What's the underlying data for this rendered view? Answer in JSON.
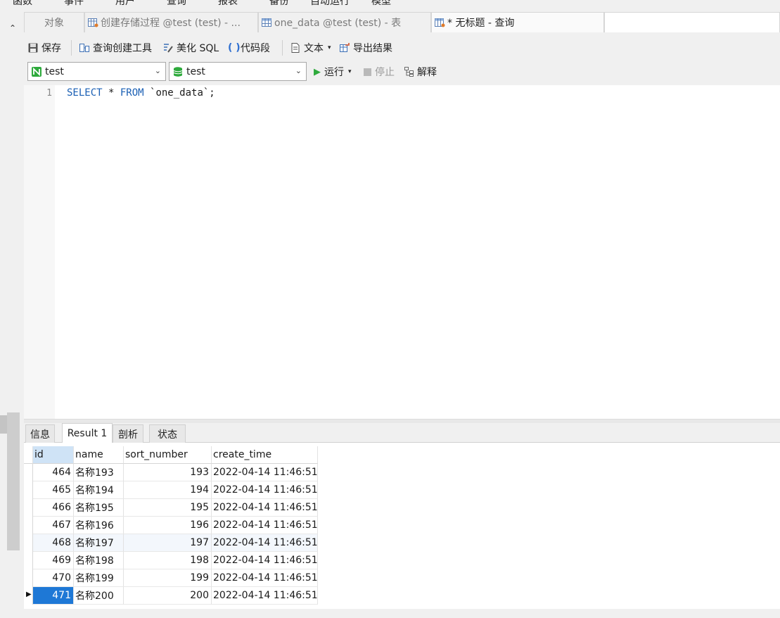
{
  "menu": [
    "函数",
    "事件",
    "用户",
    "查询",
    "报表",
    "备份",
    "自动运行",
    "模型"
  ],
  "tabs": [
    {
      "label": "对象",
      "icon": "",
      "active": false
    },
    {
      "label": "创建存储过程 @test (test) - ...",
      "icon": "procedure-table-icon",
      "active": false
    },
    {
      "label": "one_data @test (test) - 表",
      "icon": "table-icon",
      "active": false
    },
    {
      "label": "* 无标题 - 查询",
      "icon": "query-icon",
      "active": true
    }
  ],
  "toolbar": {
    "save": "保存",
    "query_builder": "查询创建工具",
    "beautify_sql": "美化 SQL",
    "code_snippet": "代码段",
    "text": "文本",
    "export_results": "导出结果"
  },
  "selectors": {
    "connection": "test",
    "database": "test",
    "run": "运行",
    "stop": "停止",
    "explain": "解释"
  },
  "editor": {
    "line_number": "1",
    "sql_keyword_select": "SELECT",
    "sql_star": " * ",
    "sql_keyword_from": "FROM",
    "sql_rest": " `one_data`;"
  },
  "result_tabs": [
    "信息",
    "Result 1",
    "剖析",
    "状态"
  ],
  "columns": [
    "id",
    "name",
    "sort_number",
    "create_time"
  ],
  "rows": [
    [
      "464",
      "名称193",
      "193",
      "2022-04-14 11:46:51"
    ],
    [
      "465",
      "名称194",
      "194",
      "2022-04-14 11:46:51"
    ],
    [
      "466",
      "名称195",
      "195",
      "2022-04-14 11:46:51"
    ],
    [
      "467",
      "名称196",
      "196",
      "2022-04-14 11:46:51"
    ],
    [
      "468",
      "名称197",
      "197",
      "2022-04-14 11:46:51"
    ],
    [
      "469",
      "名称198",
      "198",
      "2022-04-14 11:46:51"
    ],
    [
      "470",
      "名称199",
      "199",
      "2022-04-14 11:46:51"
    ],
    [
      "471",
      "名称200",
      "200",
      "2022-04-14 11:46:51"
    ]
  ],
  "colors": {
    "keyword": "#1a5fb4",
    "selected_cell": "#1e78d6",
    "run_green": "#2eaa3c",
    "header_selected": "#cfe3f6"
  }
}
